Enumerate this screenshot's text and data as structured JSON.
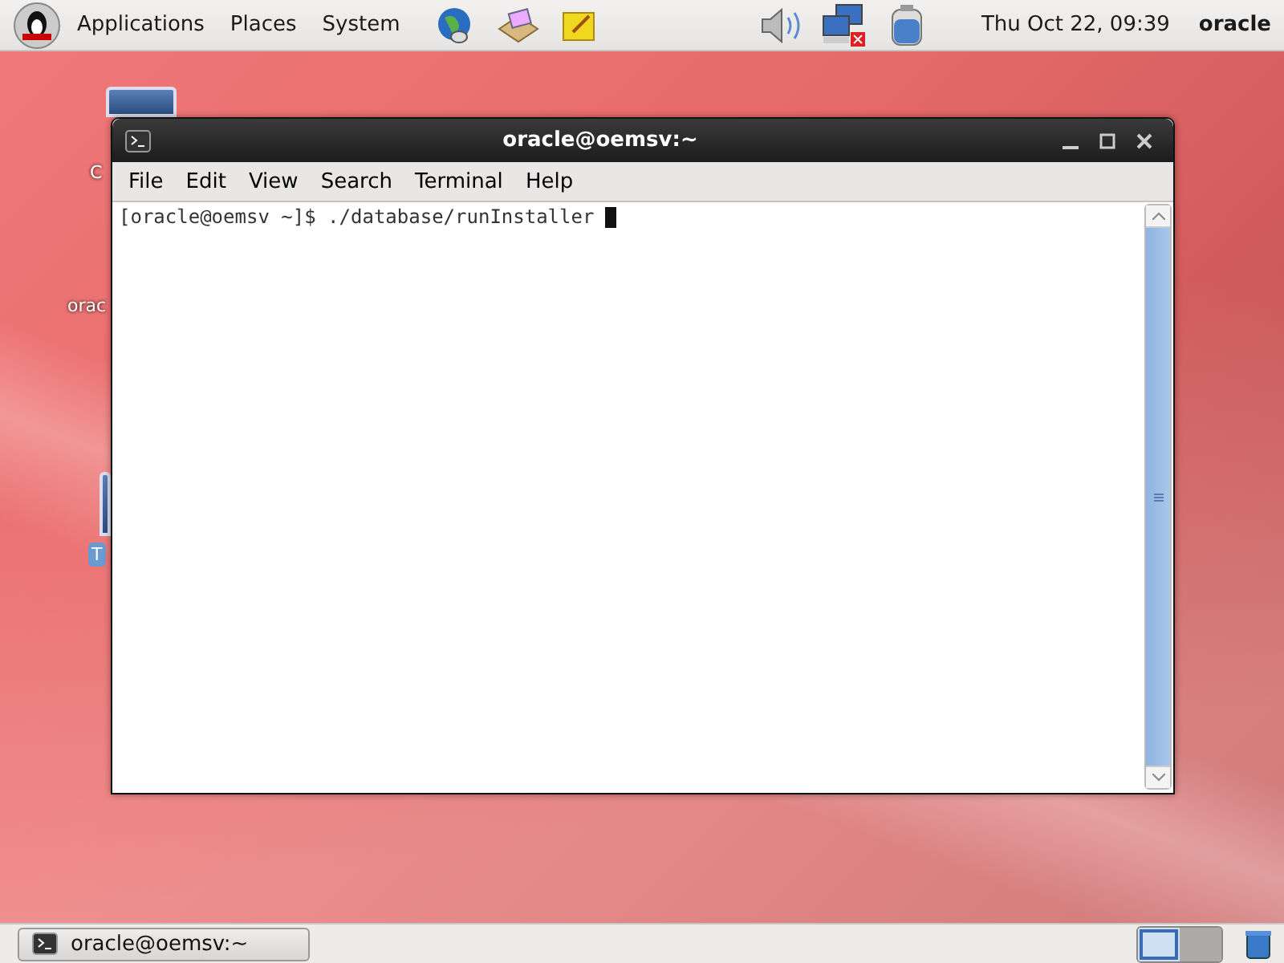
{
  "top_panel": {
    "menus": [
      {
        "label": "Applications"
      },
      {
        "label": "Places"
      },
      {
        "label": "System"
      }
    ],
    "clock": "Thu Oct 22, 09:39",
    "user": "oracle"
  },
  "desktop_icons": [
    {
      "label": "C",
      "selected": false
    },
    {
      "label": "orac",
      "selected": false
    },
    {
      "label": "T",
      "selected": true
    }
  ],
  "window": {
    "title": "oracle@oemsv:~",
    "menu": [
      "File",
      "Edit",
      "View",
      "Search",
      "Terminal",
      "Help"
    ],
    "lines": [
      "[oracle@oemsv ~]$ ./database/runInstaller"
    ]
  },
  "taskbar": {
    "tasks": [
      {
        "label": "oracle@oemsv:~",
        "selected": false
      }
    ],
    "workspaces": [
      {
        "selected": true
      },
      {
        "selected": false
      }
    ]
  }
}
